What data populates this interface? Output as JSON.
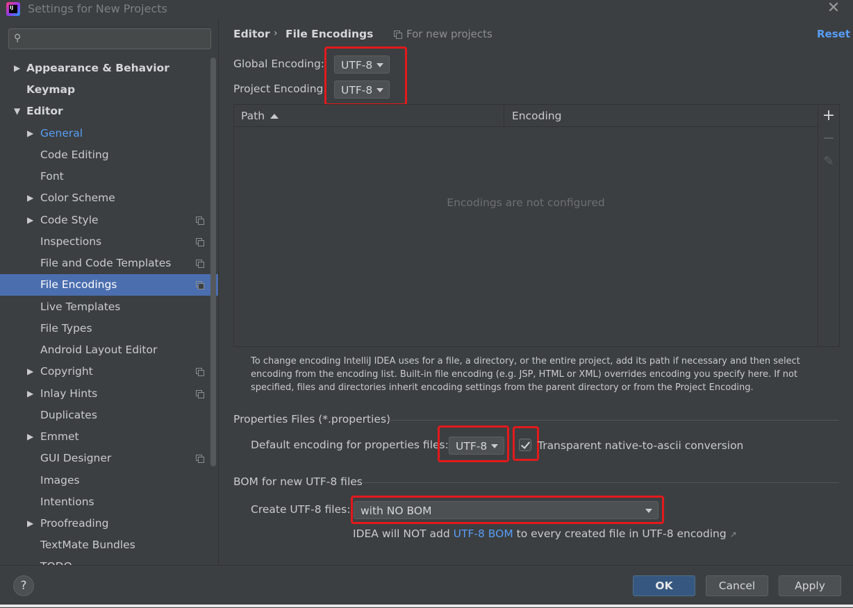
{
  "window": {
    "title": "Settings for New Projects",
    "close_glyph": "✕"
  },
  "sidebar": {
    "search_placeholder": "",
    "items": [
      {
        "label": "Appearance & Behavior"
      },
      {
        "label": "Keymap"
      },
      {
        "label": "Editor"
      },
      {
        "label": "General"
      },
      {
        "label": "Code Editing"
      },
      {
        "label": "Font"
      },
      {
        "label": "Color Scheme"
      },
      {
        "label": "Code Style"
      },
      {
        "label": "Inspections"
      },
      {
        "label": "File and Code Templates"
      },
      {
        "label": "File Encodings"
      },
      {
        "label": "Live Templates"
      },
      {
        "label": "File Types"
      },
      {
        "label": "Android Layout Editor"
      },
      {
        "label": "Copyright"
      },
      {
        "label": "Inlay Hints"
      },
      {
        "label": "Duplicates"
      },
      {
        "label": "Emmet"
      },
      {
        "label": "GUI Designer"
      },
      {
        "label": "Images"
      },
      {
        "label": "Intentions"
      },
      {
        "label": "Proofreading"
      },
      {
        "label": "TextMate Bundles"
      },
      {
        "label": "TODO"
      }
    ]
  },
  "header": {
    "breadcrumb_parent": "Editor",
    "breadcrumb_sep": "›",
    "breadcrumb_current": "File Encodings",
    "scope": "For new projects",
    "reset": "Reset"
  },
  "encodings": {
    "global_label": "Global Encoding:",
    "global_value": "UTF-8",
    "project_label": "Project Encoding:",
    "project_value": "UTF-8"
  },
  "table": {
    "columns": [
      "Path",
      "Encoding"
    ],
    "empty_text": "Encodings are not configured",
    "add": "+",
    "remove": "−",
    "edit": "✎"
  },
  "help_text": "To change encoding IntelliJ IDEA uses for a file, a directory, or the entire project, add its path if necessary and then select encoding from the encoding list. Built-in file encoding (e.g. JSP, HTML or XML) overrides encoding you specify here. If not specified, files and directories inherit encoding settings from the parent directory or from the Project Encoding.",
  "properties": {
    "section_title": "Properties Files (*.properties)",
    "default_label": "Default encoding for properties files:",
    "default_value": "UTF-8",
    "transparent_label": "Transparent native-to-ascii conversion",
    "transparent_checked": true
  },
  "bom": {
    "section_title": "BOM for new UTF-8 files",
    "create_label": "Create UTF-8 files:",
    "create_value": "with NO BOM",
    "note_prefix": "IDEA will NOT add ",
    "note_link": "UTF-8 BOM",
    "note_suffix": " to every created file in UTF-8 encoding",
    "ext_arrow": "↗"
  },
  "footer": {
    "help": "?",
    "ok": "OK",
    "cancel": "Cancel",
    "apply": "Apply"
  },
  "colors": {
    "accent": "#4b6eaf",
    "link": "#589df6",
    "highlight": "#e3191c"
  }
}
